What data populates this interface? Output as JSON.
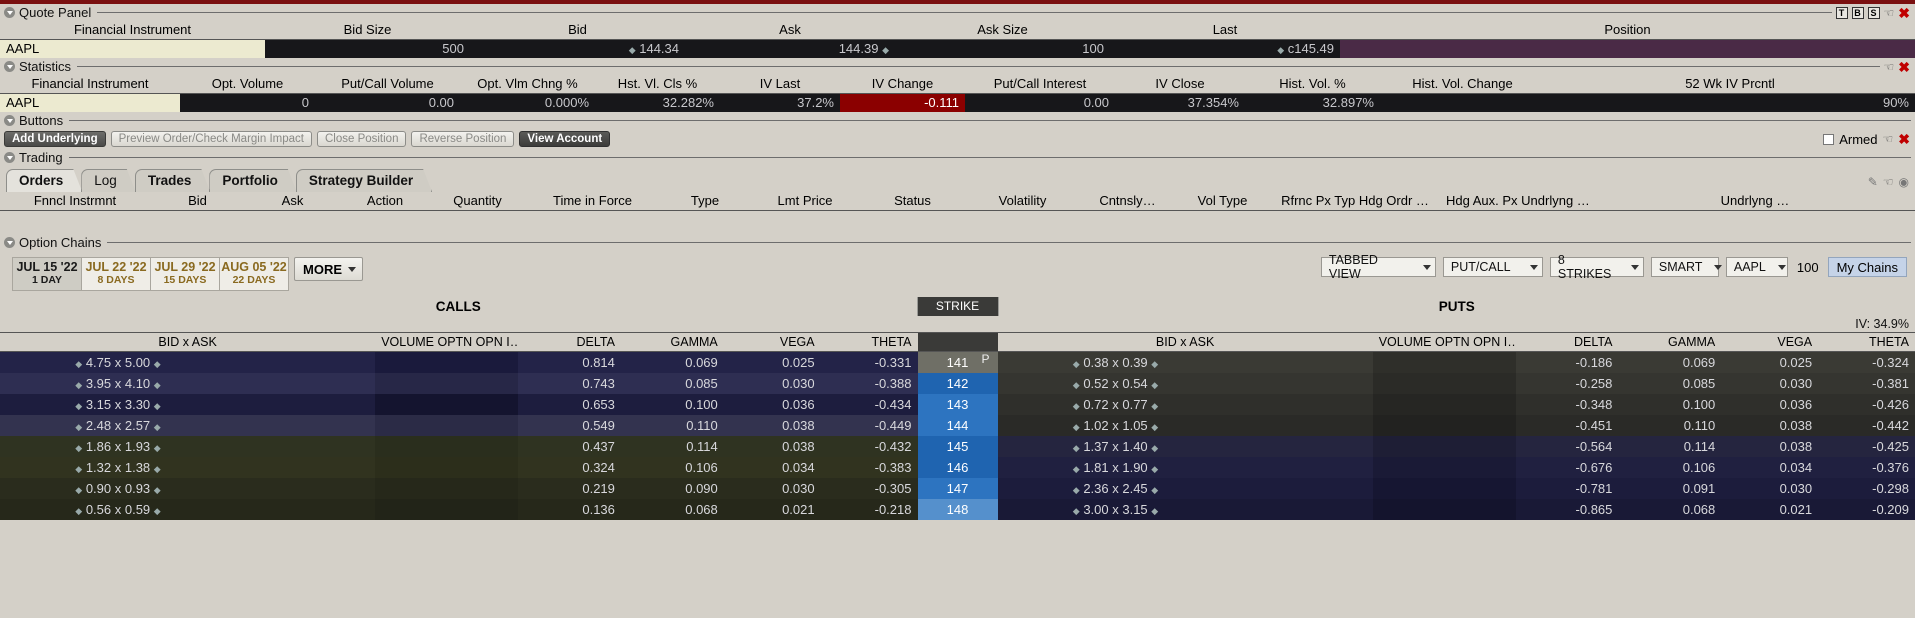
{
  "quote_panel": {
    "title": "Quote Panel",
    "icons": [
      "T",
      "B",
      "S"
    ],
    "columns": [
      "Financial Instrument",
      "Bid Size",
      "Bid",
      "Ask",
      "Ask Size",
      "Last",
      "Position"
    ],
    "row": {
      "instrument": "AAPL",
      "bid_size": "500",
      "bid": "144.34",
      "ask": "144.39",
      "ask_size": "100",
      "last": "c145.49",
      "position": ""
    }
  },
  "statistics": {
    "title": "Statistics",
    "columns": [
      "Financial Instrument",
      "Opt. Volume",
      "Put/Call Volume",
      "Opt. Vlm Chng %",
      "Hst. Vl. Cls %",
      "IV Last",
      "IV Change",
      "Put/Call Interest",
      "IV Close",
      "Hist. Vol. %",
      "Hist. Vol. Change",
      "52 Wk IV Prcntl"
    ],
    "row": {
      "instrument": "AAPL",
      "opt_volume": "0",
      "put_call_volume": "0.00",
      "opt_vlm_chng": "0.000%",
      "hst_vl_cls": "32.282%",
      "iv_last": "37.2%",
      "iv_change": "-0.111",
      "put_call_interest": "0.00",
      "iv_close": "37.354%",
      "hist_vol": "32.897%",
      "hist_vol_change": "",
      "iv_prcntl": "90%"
    },
    "iv_change_color": "#8b0000"
  },
  "buttons": {
    "title": "Buttons",
    "items": [
      {
        "label": "Add Underlying",
        "style": "dark"
      },
      {
        "label": "Preview Order/Check Margin Impact",
        "style": "light"
      },
      {
        "label": "Close Position",
        "style": "light"
      },
      {
        "label": "Reverse Position",
        "style": "light"
      },
      {
        "label": "View Account",
        "style": "darker"
      }
    ],
    "armed_label": "Armed"
  },
  "trading": {
    "title": "Trading",
    "tabs": [
      {
        "label": "Orders",
        "active": true
      },
      {
        "label": "Log",
        "active": false
      },
      {
        "label": "Trades",
        "active": false,
        "bold": true
      },
      {
        "label": "Portfolio",
        "active": false,
        "bold": true
      },
      {
        "label": "Strategy Builder",
        "active": false,
        "bold": true
      }
    ],
    "columns": [
      "Fnncl Instrmnt",
      "Bid",
      "Ask",
      "Action",
      "Quantity",
      "Time in Force",
      "Type",
      "Lmt Price",
      "Status",
      "Volatility",
      "Cntnsly…",
      "Vol Type",
      "Rfrnc Px Typ Hdg Ordr …",
      "Hdg Aux. Px Undrlyng …",
      "Undrlyng …"
    ]
  },
  "option_chains": {
    "title": "Option Chains",
    "expirations": [
      {
        "date": "JUL 15 '22",
        "days": "1 DAY",
        "active": true
      },
      {
        "date": "JUL 22 '22",
        "days": "8 DAYS",
        "active": false
      },
      {
        "date": "JUL 29 '22",
        "days": "15 DAYS",
        "active": false
      },
      {
        "date": "AUG 05 '22",
        "days": "22 DAYS",
        "active": false
      }
    ],
    "more_label": "MORE",
    "controls": {
      "view": "TABBED VIEW",
      "putcall": "PUT/CALL",
      "strikes": "8 STRIKES",
      "exchange": "SMART",
      "symbol": "AAPL",
      "multiplier": "100",
      "my_chains": "My Chains"
    },
    "calls_label": "CALLS",
    "strike_label": "STRIKE",
    "puts_label": "PUTS",
    "iv_label": "IV: 34.9%",
    "call_columns": [
      "BID x  ASK",
      "VOLUME OPTN OPN I…",
      "DELTA",
      "GAMMA",
      "VEGA",
      "THETA"
    ],
    "put_columns": [
      "BID x  ASK",
      "VOLUME OPTN OPN I…",
      "DELTA",
      "GAMMA",
      "VEGA",
      "THETA"
    ],
    "rows": [
      {
        "call_bid": "4.75",
        "call_ask": "5.00",
        "call_delta": "0.814",
        "call_gamma": "0.069",
        "call_vega": "0.025",
        "call_theta": "-0.331",
        "strike": "141",
        "put_flag": "P",
        "put_bid": "0.38",
        "put_ask": "0.39",
        "put_delta": "-0.186",
        "put_gamma": "0.069",
        "put_vega": "0.025",
        "put_theta": "-0.324"
      },
      {
        "call_bid": "3.95",
        "call_ask": "4.10",
        "call_delta": "0.743",
        "call_gamma": "0.085",
        "call_vega": "0.030",
        "call_theta": "-0.388",
        "strike": "142",
        "put_flag": "",
        "put_bid": "0.52",
        "put_ask": "0.54",
        "put_delta": "-0.258",
        "put_gamma": "0.085",
        "put_vega": "0.030",
        "put_theta": "-0.381"
      },
      {
        "call_bid": "3.15",
        "call_ask": "3.30",
        "call_delta": "0.653",
        "call_gamma": "0.100",
        "call_vega": "0.036",
        "call_theta": "-0.434",
        "strike": "143",
        "put_flag": "",
        "put_bid": "0.72",
        "put_ask": "0.77",
        "put_delta": "-0.348",
        "put_gamma": "0.100",
        "put_vega": "0.036",
        "put_theta": "-0.426"
      },
      {
        "call_bid": "2.48",
        "call_ask": "2.57",
        "call_delta": "0.549",
        "call_gamma": "0.110",
        "call_vega": "0.038",
        "call_theta": "-0.449",
        "strike": "144",
        "put_flag": "",
        "put_bid": "1.02",
        "put_ask": "1.05",
        "put_delta": "-0.451",
        "put_gamma": "0.110",
        "put_vega": "0.038",
        "put_theta": "-0.442"
      },
      {
        "call_bid": "1.86",
        "call_ask": "1.93",
        "call_delta": "0.437",
        "call_gamma": "0.114",
        "call_vega": "0.038",
        "call_theta": "-0.432",
        "strike": "145",
        "put_flag": "",
        "put_bid": "1.37",
        "put_ask": "1.40",
        "put_delta": "-0.564",
        "put_gamma": "0.114",
        "put_vega": "0.038",
        "put_theta": "-0.425"
      },
      {
        "call_bid": "1.32",
        "call_ask": "1.38",
        "call_delta": "0.324",
        "call_gamma": "0.106",
        "call_vega": "0.034",
        "call_theta": "-0.383",
        "strike": "146",
        "put_flag": "",
        "put_bid": "1.81",
        "put_ask": "1.90",
        "put_delta": "-0.676",
        "put_gamma": "0.106",
        "put_vega": "0.034",
        "put_theta": "-0.376"
      },
      {
        "call_bid": "0.90",
        "call_ask": "0.93",
        "call_delta": "0.219",
        "call_gamma": "0.090",
        "call_vega": "0.030",
        "call_theta": "-0.305",
        "strike": "147",
        "put_flag": "",
        "put_bid": "2.36",
        "put_ask": "2.45",
        "put_delta": "-0.781",
        "put_gamma": "0.091",
        "put_vega": "0.030",
        "put_theta": "-0.298"
      },
      {
        "call_bid": "0.56",
        "call_ask": "0.59",
        "call_delta": "0.136",
        "call_gamma": "0.068",
        "call_vega": "0.021",
        "call_theta": "-0.218",
        "strike": "148",
        "put_flag": "",
        "put_bid": "3.00",
        "put_ask": "3.15",
        "put_delta": "-0.865",
        "put_gamma": "0.068",
        "put_vega": "0.021",
        "put_theta": "-0.209"
      }
    ]
  }
}
